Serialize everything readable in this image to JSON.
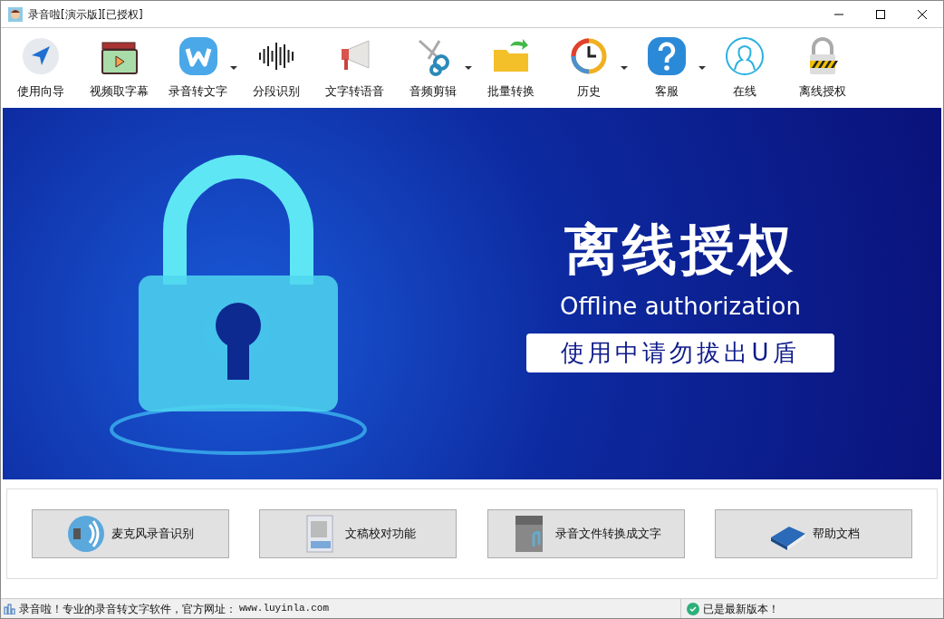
{
  "window": {
    "title": "录音啦[演示版][已授权]"
  },
  "toolbar": [
    {
      "label": "使用向导",
      "has_menu": false
    },
    {
      "label": "视频取字幕",
      "has_menu": false
    },
    {
      "label": "录音转文字",
      "has_menu": true
    },
    {
      "label": "分段识别",
      "has_menu": false
    },
    {
      "label": "文字转语音",
      "has_menu": false
    },
    {
      "label": "音频剪辑",
      "has_menu": true
    },
    {
      "label": "批量转换",
      "has_menu": false
    },
    {
      "label": "历史",
      "has_menu": true
    },
    {
      "label": "客服",
      "has_menu": true
    },
    {
      "label": "在线",
      "has_menu": false
    },
    {
      "label": "离线授权",
      "has_menu": false
    }
  ],
  "banner": {
    "title": "离线授权",
    "subtitle": "Offline authorization",
    "notice": "使用中请勿拔出U盾"
  },
  "actions": [
    "麦克风录音识别",
    "文稿校对功能",
    "录音文件转换成文字",
    "帮助文档"
  ],
  "status_bar": {
    "message": "录音啦！专业的录音转文字软件，官方网址：",
    "url": "www.luyinla.com",
    "version": "已是最新版本！"
  }
}
